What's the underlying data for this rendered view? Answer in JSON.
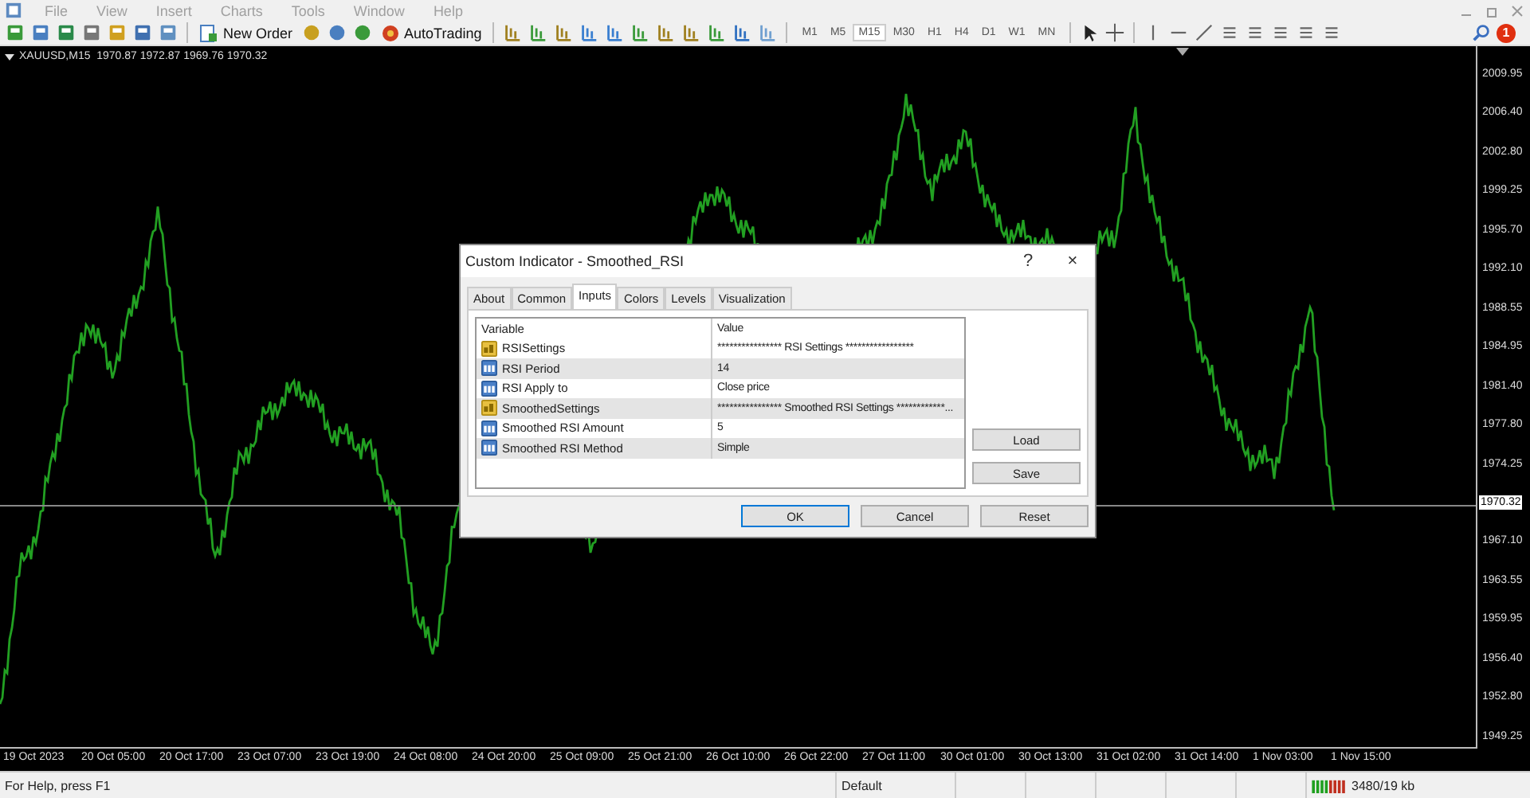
{
  "menu": [
    "File",
    "View",
    "Insert",
    "Charts",
    "Tools",
    "Window",
    "Help"
  ],
  "toolbar": {
    "new_order": "New Order",
    "autotrading": "AutoTrading",
    "timeframes": [
      {
        "label": "M1",
        "selected": false
      },
      {
        "label": "M5",
        "selected": false
      },
      {
        "label": "M15",
        "selected": true
      },
      {
        "label": "M30",
        "selected": false
      },
      {
        "label": "H1",
        "selected": false
      },
      {
        "label": "H4",
        "selected": false
      },
      {
        "label": "D1",
        "selected": false
      },
      {
        "label": "W1",
        "selected": false
      },
      {
        "label": "MN",
        "selected": false
      }
    ],
    "notification_count": "1"
  },
  "chart": {
    "header": "XAUUSD,M15  1970.87 1972.87 1969.76 1970.32",
    "price_labels": [
      {
        "text": "2009.95",
        "kind": "tick"
      },
      {
        "text": "2006.40",
        "kind": "tick"
      },
      {
        "text": "2002.80",
        "kind": "tick"
      },
      {
        "text": "1999.25",
        "kind": "tick"
      },
      {
        "text": "1995.70",
        "kind": "tick"
      },
      {
        "text": "1992.10",
        "kind": "tick"
      },
      {
        "text": "1988.55",
        "kind": "tick"
      },
      {
        "text": "1984.95",
        "kind": "tick"
      },
      {
        "text": "1981.40",
        "kind": "tick"
      },
      {
        "text": "1977.80",
        "kind": "tick"
      },
      {
        "text": "1974.25",
        "kind": "tick"
      },
      {
        "text": "1970.32",
        "kind": "current"
      },
      {
        "text": "1967.10",
        "kind": "tick"
      },
      {
        "text": "1963.55",
        "kind": "tick"
      },
      {
        "text": "1959.95",
        "kind": "tick"
      },
      {
        "text": "1956.40",
        "kind": "tick"
      },
      {
        "text": "1952.80",
        "kind": "tick"
      },
      {
        "text": "1949.25",
        "kind": "tick"
      }
    ],
    "time_labels": [
      "19 Oct 2023",
      "20 Oct 05:00",
      "20 Oct 17:00",
      "23 Oct 07:00",
      "23 Oct 19:00",
      "24 Oct 08:00",
      "24 Oct 20:00",
      "25 Oct 09:00",
      "25 Oct 21:00",
      "26 Oct 10:00",
      "26 Oct 22:00",
      "27 Oct 11:00",
      "30 Oct 01:00",
      "30 Oct 13:00",
      "31 Oct 02:00",
      "31 Oct 14:00",
      "1 Nov 03:00",
      "1 Nov 15:00"
    ]
  },
  "dialog": {
    "title": "Custom Indicator - Smoothed_RSI",
    "help": "?",
    "close": "×",
    "tabs": [
      {
        "label": "About",
        "selected": false
      },
      {
        "label": "Common",
        "selected": false
      },
      {
        "label": "Inputs",
        "selected": true
      },
      {
        "label": "Colors",
        "selected": false
      },
      {
        "label": "Levels",
        "selected": false
      },
      {
        "label": "Visualization",
        "selected": false
      }
    ],
    "columns": [
      "Variable",
      "Value"
    ],
    "rows": [
      {
        "kind": "string",
        "variable": "RSISettings",
        "value": "**************** RSI Settings *****************"
      },
      {
        "kind": "number",
        "variable": "RSI Period",
        "value": "14"
      },
      {
        "kind": "number",
        "variable": "RSI Apply to",
        "value": "Close price"
      },
      {
        "kind": "string",
        "variable": "SmoothedSettings",
        "value": "**************** Smoothed RSI Settings ************..."
      },
      {
        "kind": "number",
        "variable": "Smoothed RSI Amount",
        "value": "5"
      },
      {
        "kind": "number",
        "variable": "Smoothed RSI Method",
        "value": "Simple"
      }
    ],
    "side_buttons": [
      "Load",
      "Save"
    ],
    "buttons": [
      {
        "label": "OK",
        "kind": "default"
      },
      {
        "label": "Cancel",
        "kind": "normal"
      },
      {
        "label": "Reset",
        "kind": "normal"
      }
    ]
  },
  "status_bar": {
    "help": "For Help, press F1",
    "profile": "Default",
    "traffic": "3480/19 kb"
  }
}
